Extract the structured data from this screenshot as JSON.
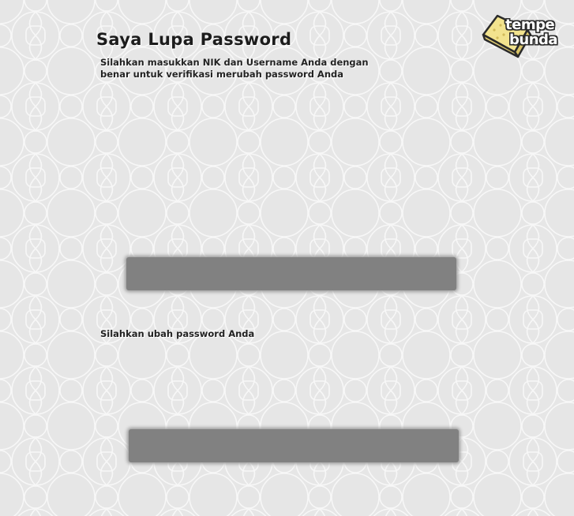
{
  "page": {
    "title": "Saya Lupa Password",
    "instruction": "Silahkan masukkan NIK dan Username Anda dengan benar untuk verifikasi merubah password Anda",
    "change_instruction": "Silahkan ubah password Anda"
  },
  "logo": {
    "word_1": "tempe",
    "word_2": "bunda",
    "icon": "tempe-block-icon",
    "colors": {
      "tempe_fill": "#f2e38e",
      "outline": "#2a2a2a",
      "text": "#ffffff"
    }
  },
  "colors": {
    "background": "#e6e6e6",
    "pattern_line": "#f7f7f7",
    "redacted_block": "#818181",
    "text": "#1c1c1c"
  }
}
